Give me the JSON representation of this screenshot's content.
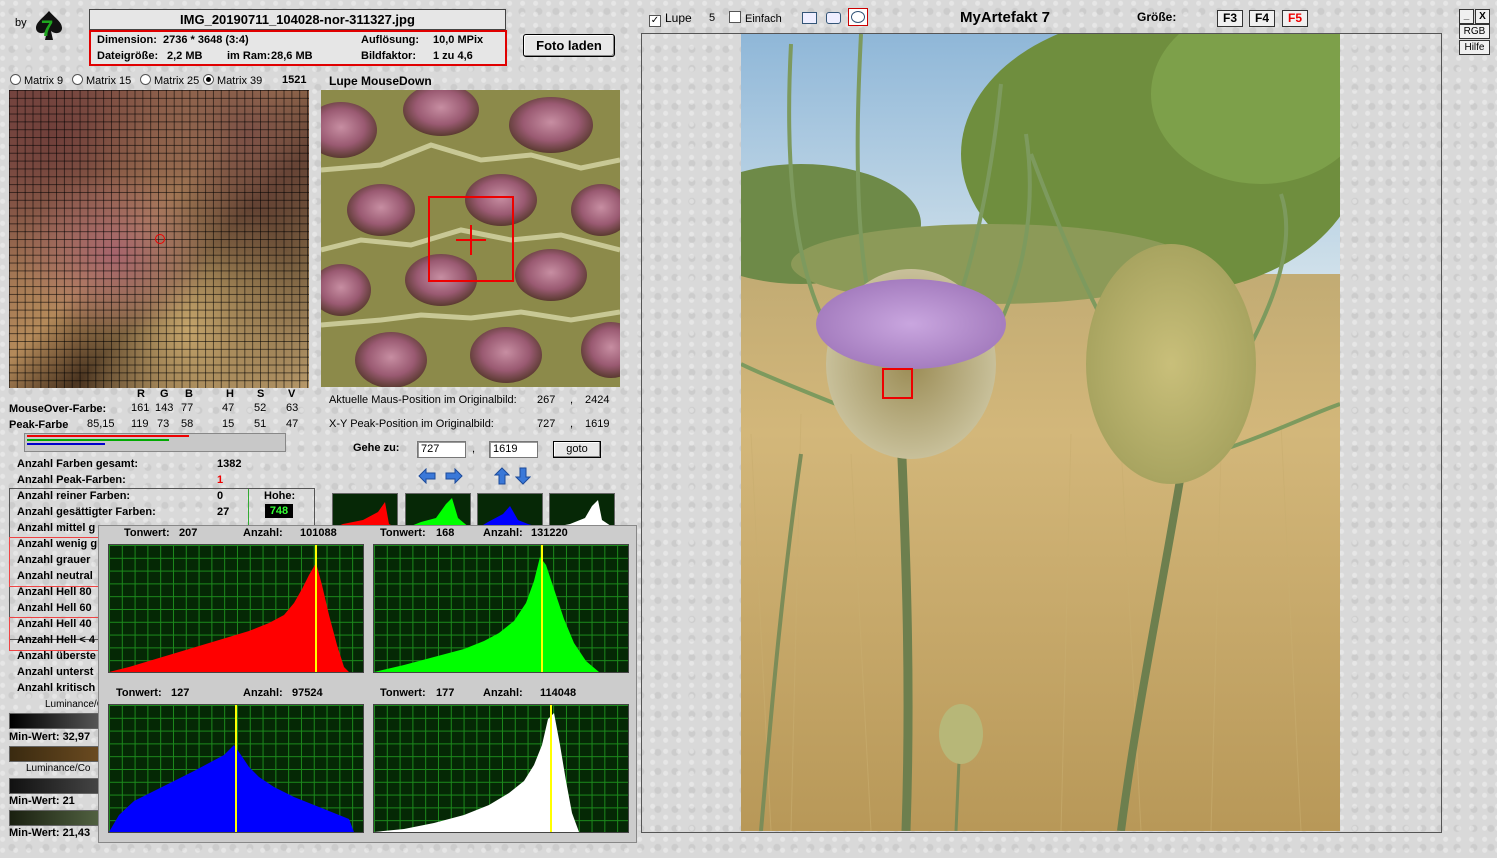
{
  "header": {
    "by": "by",
    "logo_text": "7",
    "filename": "IMG_20190711_104028-nor-311327.jpg",
    "info": {
      "dimension_label": "Dimension:",
      "dimension_value": "2736 * 3648 (3:4)",
      "filesize_label": "Dateigröße:",
      "filesize_value": "2,2 MB",
      "ram_label": "im Ram:",
      "ram_value": "28,6 MB",
      "resolution_label": "Auflösung:",
      "resolution_value": "10,0 MPix",
      "factor_label": "Bildfaktor:",
      "factor_value": "1 zu 4,6"
    },
    "load_button": "Foto laden"
  },
  "matrix": {
    "options": [
      "Matrix 9",
      "Matrix 15",
      "Matrix 25",
      "Matrix 39"
    ],
    "selected": "Matrix 39",
    "count": "1521"
  },
  "lupe": {
    "title": "Lupe MouseDown",
    "mouse_pos_label": "Aktuelle Maus-Position  im Originalbild:",
    "mouse_x": "267",
    "mouse_y": "2424",
    "peak_pos_label": "X-Y Peak-Position  im Originalbild:",
    "peak_x": "727",
    "peak_y": "1619",
    "goto_label": "Gehe zu:",
    "goto_x": "727",
    "goto_y": "1619",
    "goto_button": "goto",
    "sep": ","
  },
  "colors": {
    "headers": [
      "R",
      "G",
      "B",
      "H",
      "S",
      "V"
    ],
    "mouseover_label": "MouseOver-Farbe:",
    "mouseover_values": [
      "161",
      "143",
      "77",
      "47",
      "52",
      "63"
    ],
    "peak_label": "Peak-Farbe",
    "peak_values": [
      "85,15",
      "119",
      "73",
      "58",
      "15",
      "51",
      "47"
    ]
  },
  "stats": {
    "total_label": "Anzahl Farben gesamt:",
    "total_value": "1382",
    "peak_label": "Anzahl Peak-Farben:",
    "peak_value": "1",
    "pure_label": "Anzahl reiner Farben:",
    "pure_value": "0",
    "saturated_label": "Anzahl gesättigter Farben:",
    "saturated_value": "27",
    "medium_label": "Anzahl mittel g",
    "height_label": "Hohe:",
    "height_value": "748",
    "partial_rows": [
      "Anzahl wenig g",
      "Anzahl grauer",
      "Anzahl neutral",
      "Anzahl Hell 80",
      "Anzahl Hell 60",
      "Anzahl Hell 40",
      "Anzahl Hell < 4",
      "Anzahl überste",
      "Anzahl unterst",
      "Anzahl kritisch"
    ],
    "lum1": "Luminance/C",
    "min1": "Min-Wert: 32,97",
    "lum2": "Luminance/Co",
    "min2": "Min-Wert: 21",
    "min3": "Min-Wert: 21,43"
  },
  "histograms": [
    {
      "name": "red",
      "tonwert_label": "Tonwert:",
      "tonwert": "207",
      "anzahl_label": "Anzahl:",
      "anzahl": "101088",
      "color": "#ff0000",
      "peak": 207
    },
    {
      "name": "green",
      "tonwert_label": "Tonwert:",
      "tonwert": "168",
      "anzahl_label": "Anzahl:",
      "anzahl": "131220",
      "color": "#00ff00",
      "peak": 168
    },
    {
      "name": "blue",
      "tonwert_label": "Tonwert:",
      "tonwert": "127",
      "anzahl_label": "Anzahl:",
      "anzahl": "97524",
      "color": "#0000ff",
      "peak": 127
    },
    {
      "name": "white",
      "tonwert_label": "Tonwert:",
      "tonwert": "177",
      "anzahl_label": "Anzahl:",
      "anzahl": "114048",
      "color": "#ffffff",
      "peak": 177
    }
  ],
  "toolbar": {
    "lupe_label": "Lupe",
    "lupe_checked": true,
    "lupe_value": "5",
    "einfach_label": "Einfach",
    "title": "MyArtefakt 7",
    "size_label": "Größe:",
    "f3": "F3",
    "f4": "F4",
    "f5": "F5",
    "min_btn": "_",
    "close_btn": "X",
    "rgb_btn": "RGB",
    "help_btn": "Hilfe"
  }
}
